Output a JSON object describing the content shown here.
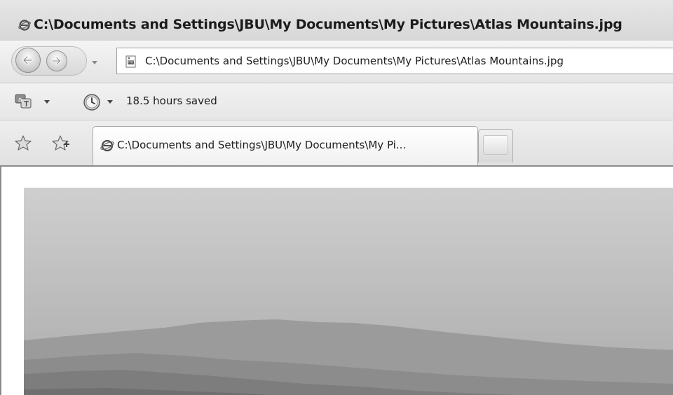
{
  "window": {
    "title": "C:\\Documents and Settings\\JBU\\My Documents\\My Pictures\\Atlas Mountains.jpg"
  },
  "address_bar": {
    "value": "C:\\Documents and Settings\\JBU\\My Documents\\My Pictures\\Atlas Mountains.jpg"
  },
  "command_bar": {
    "status_text": "18.5 hours saved"
  },
  "tabs": [
    {
      "label": "C:\\Documents and Settings\\JBU\\My Documents\\My Pi..."
    }
  ],
  "icons": {
    "title": "ie-icon",
    "back": "back-arrow-icon",
    "forward": "forward-arrow-icon",
    "address": "image-file-icon",
    "translate": "translate-icon",
    "clock": "clock-icon",
    "favorites": "favorites-star-icon",
    "add_favorites": "add-favorites-icon"
  }
}
